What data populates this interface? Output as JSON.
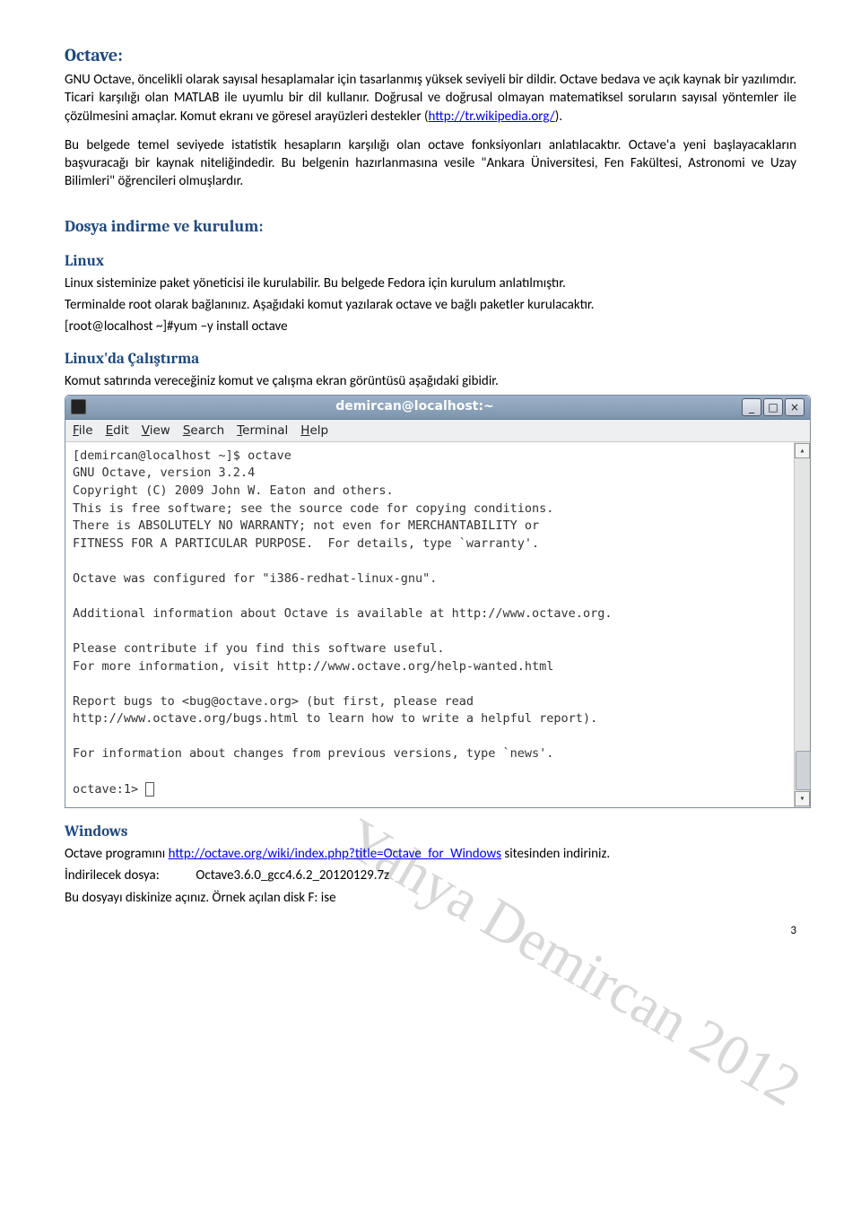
{
  "sections": {
    "octave_h": "Octave:",
    "octave_p1_a": "GNU Octave, öncelikli olarak sayısal hesaplamalar için tasarlanmış yüksek seviyeli bir dildir. Octave bedava ve açık kaynak bir yazılımdır. Ticari karşılığı olan MATLAB ile uyumlu bir dil kullanır. Doğrusal ve doğrusal olmayan matematiksel soruların sayısal yöntemler ile çözülmesini amaçlar. Komut ekranı ve göresel arayüzleri destekler (",
    "octave_link1": "http://tr.wikipedia.org/",
    "octave_p1_b": ").",
    "octave_p2": "Bu belgede temel seviyede istatistik hesapların karşılığı olan octave fonksiyonları anlatılacaktır. Octave'a yeni başlayacakların başvuracağı bir kaynak niteliğindedir. Bu belgenin hazırlanmasına vesile \"Ankara Üniversitesi, Fen Fakültesi, Astronomi ve Uzay Bilimleri\" öğrencileri olmuşlardır.",
    "dosya_h": "Dosya indirme ve kurulum:",
    "linux_h": "Linux",
    "linux_p1": "Linux sisteminize paket yöneticisi ile kurulabilir. Bu belgede Fedora için kurulum anlatılmıştır.",
    "linux_p2": "Terminalde root olarak bağlanınız. Aşağıdaki komut yazılarak octave ve bağlı paketler kurulacaktır.",
    "linux_cmd": "[root@localhost ~]#yum –y install octave",
    "linuxrun_h": "Linux'da Çalıştırma",
    "linuxrun_p": "Komut satırında vereceğiniz komut ve çalışma ekran görüntüsü aşağıdaki gibidir.",
    "windows_h": "Windows",
    "windows_p1_a": "Octave programını ",
    "windows_link": "http://octave.org/wiki/index.php?title=Octave_for_Windows",
    "windows_p1_b": " sitesinden indiriniz.",
    "windows_p2": "İndirilecek dosya:            Octave3.6.0_gcc4.6.2_20120129.7z",
    "windows_p3": "Bu dosyayı diskinize açınız. Örnek açılan disk F: ise"
  },
  "watermark": "Yahya Demircan 2012",
  "terminal": {
    "title": "demircan@localhost:~",
    "menu": [
      "File",
      "Edit",
      "View",
      "Search",
      "Terminal",
      "Help"
    ],
    "lines": [
      "[demircan@localhost ~]$ octave",
      "GNU Octave, version 3.2.4",
      "Copyright (C) 2009 John W. Eaton and others.",
      "This is free software; see the source code for copying conditions.",
      "There is ABSOLUTELY NO WARRANTY; not even for MERCHANTABILITY or",
      "FITNESS FOR A PARTICULAR PURPOSE.  For details, type `warranty'.",
      "",
      "Octave was configured for \"i386-redhat-linux-gnu\".",
      "",
      "Additional information about Octave is available at http://www.octave.org.",
      "",
      "Please contribute if you find this software useful.",
      "For more information, visit http://www.octave.org/help-wanted.html",
      "",
      "Report bugs to <bug@octave.org> (but first, please read",
      "http://www.octave.org/bugs.html to learn how to write a helpful report).",
      "",
      "For information about changes from previous versions, type `news'.",
      ""
    ],
    "prompt": "octave:1> "
  },
  "page_number": "3"
}
